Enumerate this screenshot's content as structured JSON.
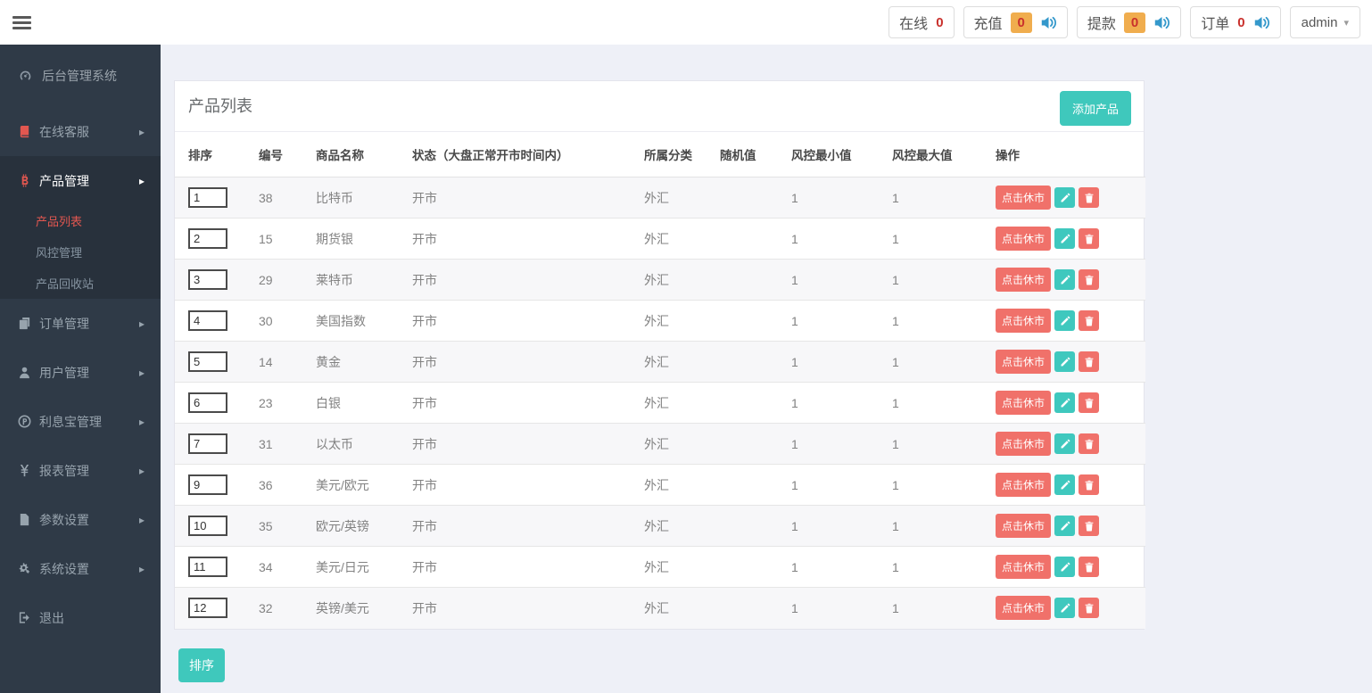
{
  "colors": {
    "teal": "#3fc8bc",
    "salmon": "#f0716a",
    "badge_orange": "#f0ad4e",
    "count_red": "#c9302c",
    "speaker_blue": "#3498cb",
    "sidebar_bg": "#2f3a47",
    "sidebar_active_bg": "#28313c",
    "active_red": "#e25750",
    "page_bg": "#eef0f7"
  },
  "topbar": {
    "stats": [
      {
        "name": "online",
        "label": "在线",
        "count": "0",
        "badge": false,
        "speaker": false
      },
      {
        "name": "recharge",
        "label": "充值",
        "count": "0",
        "badge": true,
        "speaker": true
      },
      {
        "name": "withdraw",
        "label": "提款",
        "count": "0",
        "badge": true,
        "speaker": true
      },
      {
        "name": "order",
        "label": "订单",
        "count": "0",
        "badge": false,
        "speaker": true
      }
    ],
    "user": {
      "name": "admin"
    }
  },
  "sidebar": {
    "brand": {
      "label": "后台管理系统",
      "icon": "dashboard-icon"
    },
    "items": [
      {
        "name": "online-service",
        "label": "在线客服",
        "icon": "book-icon",
        "icon_color": "#e25750",
        "arrow": true,
        "active": false,
        "open": false,
        "children": []
      },
      {
        "name": "product-management",
        "label": "产品管理",
        "icon": "bitcoin-icon",
        "icon_color": "#e25750",
        "arrow": true,
        "active": true,
        "open": true,
        "children": [
          {
            "name": "product-list",
            "label": "产品列表",
            "active": true
          },
          {
            "name": "risk-management",
            "label": "风控管理",
            "active": false
          },
          {
            "name": "product-recycle",
            "label": "产品回收站",
            "active": false
          }
        ]
      },
      {
        "name": "order-management",
        "label": "订单管理",
        "icon": "files-icon",
        "icon_color": "",
        "arrow": true,
        "active": false,
        "open": false,
        "children": []
      },
      {
        "name": "user-management",
        "label": "用户管理",
        "icon": "user-icon",
        "icon_color": "",
        "arrow": true,
        "active": false,
        "open": false,
        "children": []
      },
      {
        "name": "interest-management",
        "label": "利息宝管理",
        "icon": "p-circle-icon",
        "icon_color": "",
        "arrow": true,
        "active": false,
        "open": false,
        "children": []
      },
      {
        "name": "report-management",
        "label": "报表管理",
        "icon": "yen-icon",
        "icon_color": "",
        "arrow": true,
        "active": false,
        "open": false,
        "children": []
      },
      {
        "name": "parameter-settings",
        "label": "参数设置",
        "icon": "file-icon",
        "icon_color": "",
        "arrow": true,
        "active": false,
        "open": false,
        "children": []
      },
      {
        "name": "system-settings",
        "label": "系统设置",
        "icon": "gears-icon",
        "icon_color": "",
        "arrow": true,
        "active": false,
        "open": false,
        "children": []
      },
      {
        "name": "logout",
        "label": "退出",
        "icon": "signout-icon",
        "icon_color": "",
        "arrow": false,
        "active": false,
        "open": false,
        "children": []
      }
    ]
  },
  "panel": {
    "title": "产品列表",
    "add_button": "添加产品",
    "sort_button": "排序",
    "table": {
      "headers": [
        "排序",
        "编号",
        "商品名称",
        "状态（大盘正常开市时间内）",
        "所属分类",
        "随机值",
        "风控最小值",
        "风控最大值",
        "操作"
      ],
      "action_close_label": "点击休市",
      "rows": [
        {
          "sort": "1",
          "id": "38",
          "name": "比特币",
          "status": "开市",
          "category": "外汇",
          "random": "",
          "risk_min": "1",
          "risk_max": "1"
        },
        {
          "sort": "2",
          "id": "15",
          "name": "期货银",
          "status": "开市",
          "category": "外汇",
          "random": "",
          "risk_min": "1",
          "risk_max": "1"
        },
        {
          "sort": "3",
          "id": "29",
          "name": "莱特币",
          "status": "开市",
          "category": "外汇",
          "random": "",
          "risk_min": "1",
          "risk_max": "1"
        },
        {
          "sort": "4",
          "id": "30",
          "name": "美国指数",
          "status": "开市",
          "category": "外汇",
          "random": "",
          "risk_min": "1",
          "risk_max": "1"
        },
        {
          "sort": "5",
          "id": "14",
          "name": "黄金",
          "status": "开市",
          "category": "外汇",
          "random": "",
          "risk_min": "1",
          "risk_max": "1"
        },
        {
          "sort": "6",
          "id": "23",
          "name": "白银",
          "status": "开市",
          "category": "外汇",
          "random": "",
          "risk_min": "1",
          "risk_max": "1"
        },
        {
          "sort": "7",
          "id": "31",
          "name": "以太币",
          "status": "开市",
          "category": "外汇",
          "random": "",
          "risk_min": "1",
          "risk_max": "1"
        },
        {
          "sort": "9",
          "id": "36",
          "name": "美元/欧元",
          "status": "开市",
          "category": "外汇",
          "random": "",
          "risk_min": "1",
          "risk_max": "1"
        },
        {
          "sort": "10",
          "id": "35",
          "name": "欧元/英镑",
          "status": "开市",
          "category": "外汇",
          "random": "",
          "risk_min": "1",
          "risk_max": "1"
        },
        {
          "sort": "11",
          "id": "34",
          "name": "美元/日元",
          "status": "开市",
          "category": "外汇",
          "random": "",
          "risk_min": "1",
          "risk_max": "1"
        },
        {
          "sort": "12",
          "id": "32",
          "name": "英镑/美元",
          "status": "开市",
          "category": "外汇",
          "random": "",
          "risk_min": "1",
          "risk_max": "1"
        }
      ]
    }
  }
}
